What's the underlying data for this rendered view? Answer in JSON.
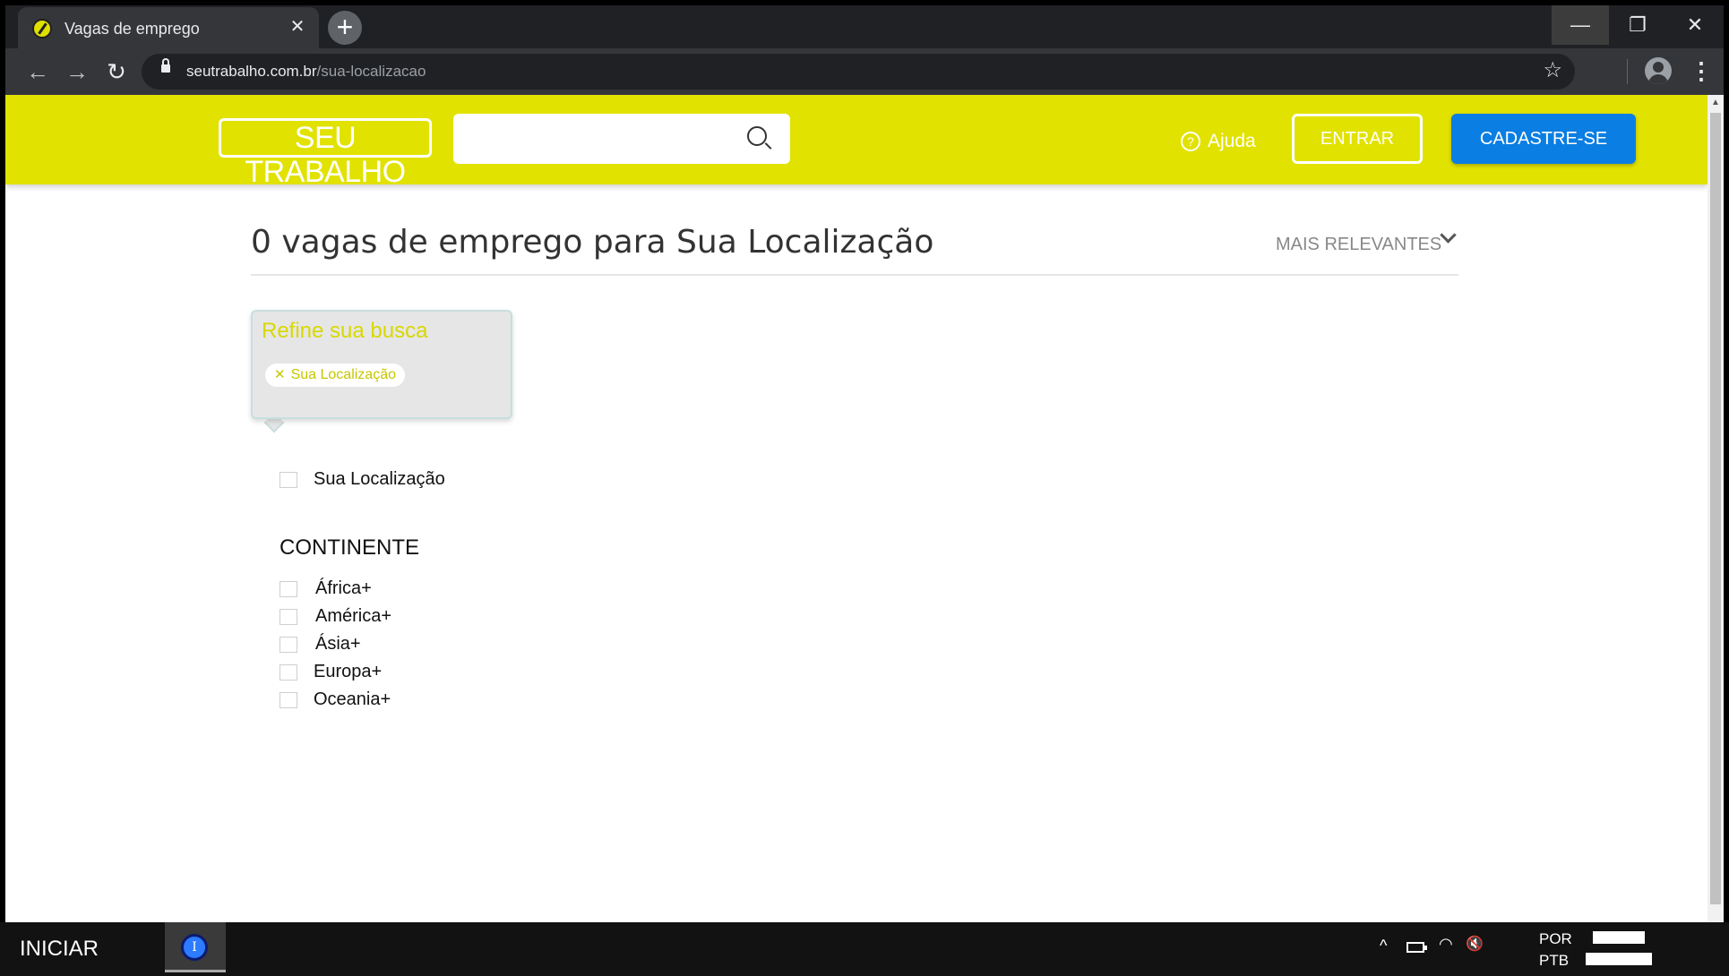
{
  "browser": {
    "tab_title": "Vagas de emprego",
    "tab_close": "✕",
    "new_tab": "+",
    "url_domain": "seutrabalho.com.br",
    "url_path": "/sua-localizacao",
    "window": {
      "minimize": "—",
      "maximize": "❐",
      "close": "✕"
    },
    "nav": {
      "back": "←",
      "forward": "→",
      "reload": "↻"
    },
    "star": "☆",
    "menu": "⋮"
  },
  "header": {
    "logo": "SEU TRABALHO",
    "search_placeholder": "",
    "help_icon": "?",
    "help_label": "Ajuda",
    "login_label": "ENTRAR",
    "signup_label": "CADASTRE-SE"
  },
  "results": {
    "title": "0 vagas de emprego para Sua Localização",
    "sort_label": "MAIS RELEVANTES"
  },
  "refine": {
    "title": "Refine sua busca",
    "chip_x": "✕",
    "chip_label": "Sua Localização"
  },
  "filters": {
    "location_option": "Sua Localização",
    "continent_title": "CONTINENTE",
    "continents": [
      "África+",
      "América+",
      "Ásia+",
      "Europa+",
      "Oceania+"
    ]
  },
  "taskbar": {
    "start_label": "INICIAR",
    "app_icon_letter": "I",
    "tray_up": "^",
    "lang_top": "POR",
    "lang_bottom": "PTB",
    "volume": "🔇"
  },
  "colors": {
    "brand_yellow": "#e2e200",
    "primary_blue": "#0a7ee2",
    "chip_text": "#c6c600"
  }
}
